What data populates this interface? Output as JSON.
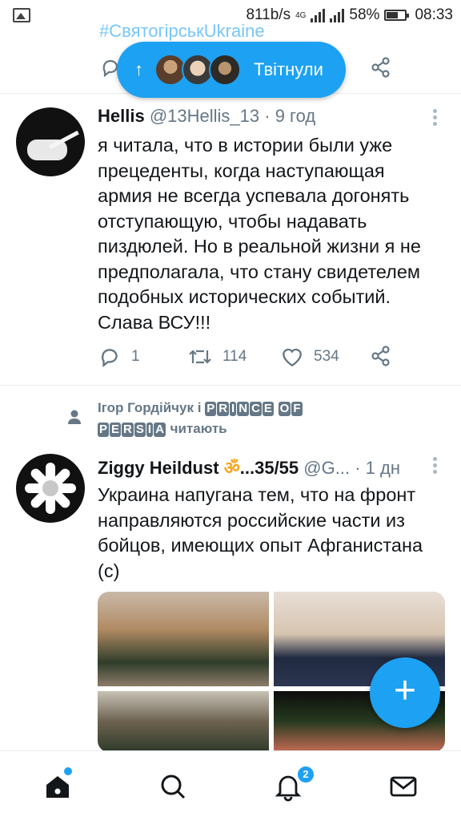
{
  "status_bar": {
    "speed": "811b/s",
    "network": "4G",
    "battery": "58%",
    "time": "08:33"
  },
  "previous_tweet": {
    "hashtags": "#СвятогірськUkraine"
  },
  "retweet_pill": {
    "label": "Твітнули"
  },
  "tweets": [
    {
      "name": "Hellis",
      "handle": "@13Hellis_13",
      "time": "· 9 год",
      "text": "я читала, что в истории были уже прецеденты, когда наступающая армия не всегда успевала догонять отступающую, чтобы надавать пиздюлей. Но в реальной жизни я не предполагала, что стану свидетелем подобных исторических событий. Слава ВСУ!!!",
      "replies": "1",
      "retweets": "114",
      "likes": "534"
    },
    {
      "followed_note": {
        "prefix": "Ігор Гордійчук і",
        "word1": [
          "P",
          "R",
          "I",
          "N",
          "C",
          "E"
        ],
        "word2": [
          "O",
          "F"
        ],
        "word3": [
          "P",
          "E",
          "R",
          "S",
          "I",
          "A"
        ],
        "suffix": "читають"
      },
      "name": "Ziggy Heildust",
      "name_symbol": "ॐ",
      "name_tail": "...35/55",
      "handle": "@G...",
      "time": "· 1 дн",
      "text": "Украина напугана тем, что на фронт направляются российские части из бойцов, имеющих опыт Афганистана (с)"
    }
  ],
  "bottom_nav": {
    "notifications_count": "2"
  },
  "colors": {
    "accent": "#1da1f2",
    "text_secondary": "#657786"
  },
  "icons": [
    "image-icon",
    "signal-icon",
    "battery-icon",
    "reply-icon",
    "retweet-icon",
    "like-icon",
    "share-icon",
    "more-icon",
    "person-icon",
    "home-icon",
    "search-icon",
    "bell-icon",
    "mail-icon",
    "plus-icon"
  ]
}
